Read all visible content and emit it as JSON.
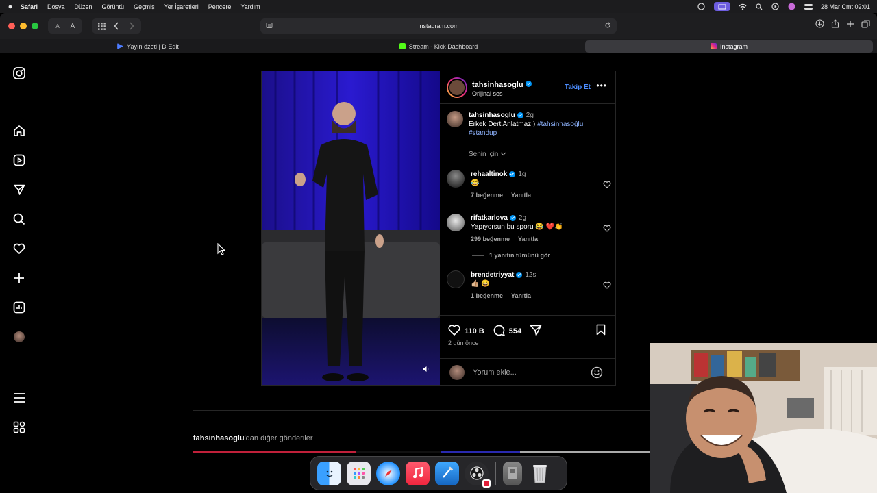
{
  "menubar": {
    "app": "Safari",
    "items": [
      "Dosya",
      "Düzen",
      "Görüntü",
      "Geçmiş",
      "Yer İşaretleri",
      "Pencere",
      "Yardım"
    ],
    "datetime": "28 Mar Cmt  02:01"
  },
  "toolbar": {
    "text_small": "A",
    "text_large": "A",
    "url": "instagram.com"
  },
  "tabs": [
    {
      "label": "Yayın özeti | D Edit",
      "icon_color": "#4d7cff",
      "active": false
    },
    {
      "label": "Stream - Kick Dashboard",
      "icon_color": "#53fc18",
      "active": false
    },
    {
      "label": "Instagram",
      "icon_color": "#e1306c",
      "active": true
    }
  ],
  "post": {
    "author": "tahsinhasoglu",
    "audio": "Orijinal ses",
    "follow_label": "Takip Et",
    "caption": {
      "user": "tahsinhasoglu",
      "time": "2g",
      "text": "Erkek Dert Anlatmaz:)",
      "hashtag1": "#tahsinhasoğlu",
      "hashtag2": "#standup"
    },
    "sort_label": "Senin için",
    "comments": [
      {
        "user": "rehaaltinok",
        "time": "1g",
        "text": "😂",
        "likes": "7 beğenme",
        "reply": "Yanıtla"
      },
      {
        "user": "rifatkarlova",
        "time": "2g",
        "text": "Yapıyorsun bu sporu 😂 ❤️👏",
        "likes": "299 beğenme",
        "reply": "Yanıtla"
      },
      {
        "user": "brendetriyyat",
        "time": "12s",
        "text": "👍🏼 😀",
        "likes": "1 beğenme",
        "reply": "Yanıtla"
      }
    ],
    "view_replies": "1 yanıtın tümünü gör",
    "like_count": "110 B",
    "comment_count": "554",
    "posted_ago": "2 gün önce",
    "add_comment_placeholder": "Yorum ekle..."
  },
  "more_posts": {
    "user": "tahsinhasoglu",
    "suffix": "'dan diğer gönderiler"
  },
  "dock": [
    "finder-icon",
    "launchpad-icon",
    "safari-icon",
    "music-icon",
    "xcode-icon",
    "obs-icon",
    "preview-icon",
    "trash-icon"
  ]
}
